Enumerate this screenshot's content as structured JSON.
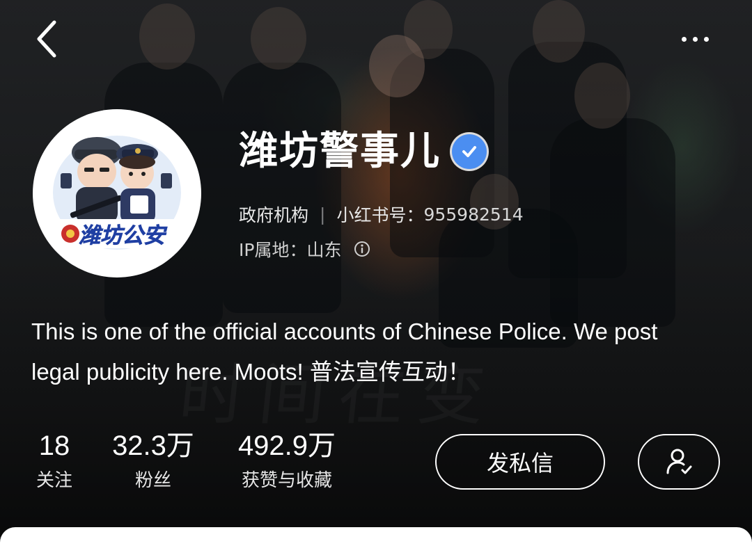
{
  "header": {
    "back_icon": "chevron-left-icon",
    "more_icon": "more-dots-icon"
  },
  "profile": {
    "avatar_text": "潍坊公安",
    "name": "潍坊警事儿",
    "verified_icon": "verified-check-icon",
    "account_type": "政府机构",
    "separator": "|",
    "red_id_label": "小红书号：",
    "red_id": "955982514",
    "ip_label": "IP属地：",
    "ip_location": "山东",
    "info_icon": "info-circle-icon",
    "bio": "This is one of the official accounts of Chinese Police. We post legal publicity here. Moots! 普法宣传互动！"
  },
  "stats": [
    {
      "value": "18",
      "label": "关注"
    },
    {
      "value": "32.3万",
      "label": "粉丝"
    },
    {
      "value": "492.9万",
      "label": "获赞与收藏"
    }
  ],
  "actions": {
    "message_label": "发私信",
    "follow_icon": "user-check-icon"
  },
  "colors": {
    "verified_blue": "#4b8ef1",
    "background_dark": "#1a1b1d"
  }
}
